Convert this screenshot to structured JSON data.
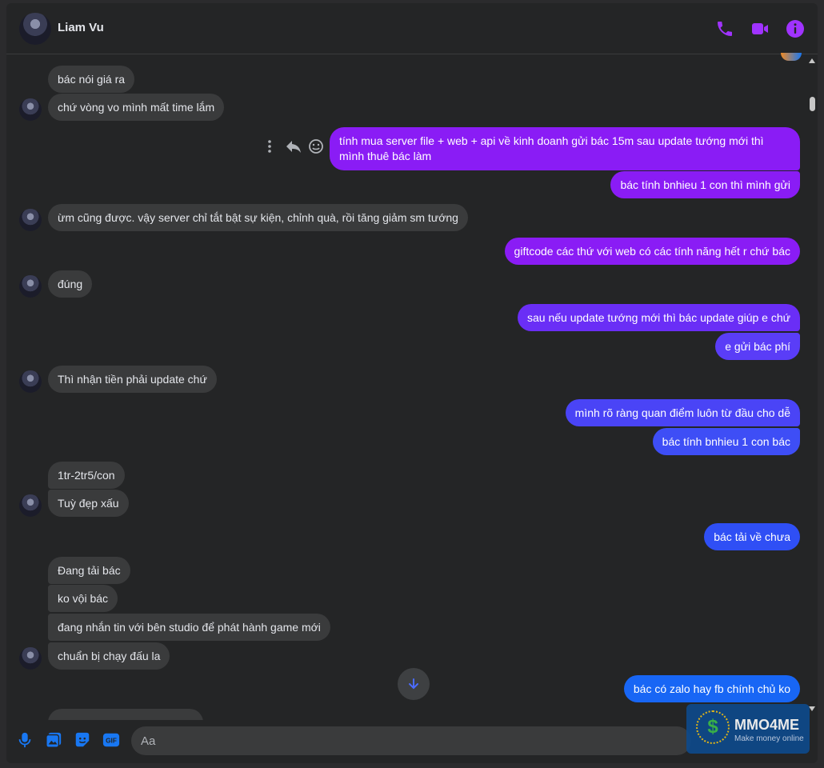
{
  "header": {
    "contact_name": "Liam Vu",
    "icons": [
      "phone-icon",
      "video-call-icon",
      "info-icon"
    ],
    "accent": "#a033ff"
  },
  "messages": [
    {
      "dir": "in",
      "text": "bác nói giá ra"
    },
    {
      "dir": "in",
      "text": "chứ vòng vo mình mất time lắm",
      "avatar": true
    },
    {
      "dir": "out",
      "text": "tính mua server file + web + api về kinh doanh gửi bác 15m sau update tướng mới thì mình thuê bác làm"
    },
    {
      "dir": "out",
      "text": "bác tính bnhieu 1 con thì mình gửi"
    },
    {
      "dir": "in",
      "text": "ừm cũng được. vậy server chỉ tắt bật sự kiện, chỉnh quà, rồi tăng giảm sm tướng",
      "avatar": true
    },
    {
      "dir": "out",
      "text": "giftcode các thứ với web có các tính năng hết r chứ bác"
    },
    {
      "dir": "in",
      "text": "đúng",
      "avatar": true
    },
    {
      "dir": "out",
      "text": "sau nếu update tướng mới thì bác update giúp e chứ"
    },
    {
      "dir": "out",
      "text": "e gửi bác phí"
    },
    {
      "dir": "in",
      "text": "Thì nhận tiền phải update chứ",
      "avatar": true
    },
    {
      "dir": "out",
      "text": "mình rõ ràng quan điểm luôn từ đầu cho dễ"
    },
    {
      "dir": "out",
      "text": "bác tính bnhieu 1 con bác"
    },
    {
      "dir": "in",
      "text": "1tr-2tr5/con"
    },
    {
      "dir": "in",
      "text": "Tuỳ đẹp xấu",
      "avatar": true
    },
    {
      "dir": "out",
      "text": "bác tải về chưa"
    },
    {
      "dir": "in",
      "text": "Đang tải bác"
    },
    {
      "dir": "in",
      "text": "ko vội bác"
    },
    {
      "dir": "in",
      "text": "đang nhắn tin với bên studio để phát hành game mới"
    },
    {
      "dir": "in",
      "text": "chuẩn bị chạy đấu la",
      "avatar": true
    },
    {
      "dir": "out",
      "text": "bác có zalo hay fb chính chủ ko"
    }
  ],
  "message_actions": [
    "more-options-icon",
    "reply-icon",
    "react-icon"
  ],
  "composer": {
    "placeholder": "Aa",
    "icons": [
      "microphone-icon",
      "photo-icon",
      "sticker-icon",
      "gif-icon"
    ],
    "gif_label": "GIF"
  },
  "watermark": {
    "title": "MMO4ME",
    "subtitle": "Make money online",
    "symbol": "$"
  },
  "colors": {
    "bubble_in": "#3a3b3c",
    "bubble_out_top": "#8a1cf5",
    "bubble_out_bottom": "#1e55f5",
    "window_bg": "#242526"
  }
}
